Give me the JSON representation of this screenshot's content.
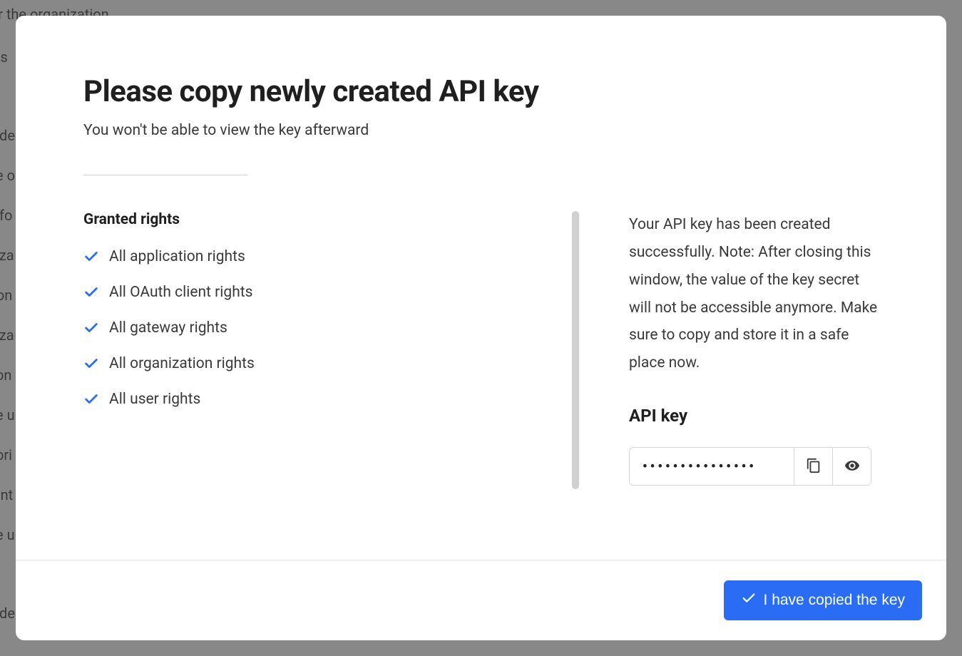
{
  "modal": {
    "title": "Please copy newly created API key",
    "subtitle": "You won't be able to view the key afterward",
    "granted_rights_label": "Granted rights",
    "rights": [
      "All application rights",
      "All OAuth client rights",
      "All gateway rights",
      "All organization rights",
      "All user rights"
    ],
    "info_text": "Your API key has been created successfully. Note: After closing this window, the value of the key secret will not be accessible anymore. Make sure to copy and store it in a safe place now.",
    "api_key_label": "API key",
    "api_key_masked": "•••••••••••••••",
    "confirm_button": "I have copied the key"
  },
  "backdrop_lines": [
    "ent under the organization",
    "ts",
    "nde",
    "e o",
    "nfo",
    "iza",
    "ion",
    "iza",
    "on",
    "e u",
    "ori",
    "ent",
    "e u",
    "nde"
  ],
  "colors": {
    "accent": "#2a6df4",
    "text_primary": "#1f1f1f",
    "text_secondary": "#3a3a3a",
    "border": "#d6d6d6"
  }
}
